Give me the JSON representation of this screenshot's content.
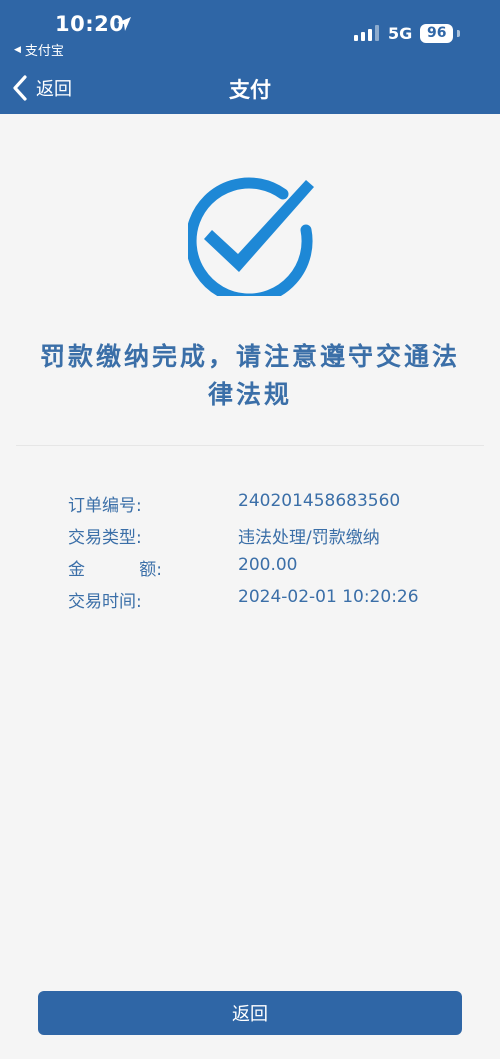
{
  "status_bar": {
    "time": "10:20",
    "back_app": "支付宝",
    "network": "5G",
    "battery": "96"
  },
  "nav": {
    "back_label": "返回",
    "title": "支付"
  },
  "result": {
    "message": "罚款缴纳完成，请注意遵守交通法律法规"
  },
  "details": {
    "order_no": {
      "label": "订单编号:",
      "value": "240201458683560"
    },
    "type": {
      "label": "交易类型:",
      "value": "违法处理/罚款缴纳"
    },
    "amount": {
      "label_chars": [
        "金",
        "额:"
      ],
      "value": "200.00"
    },
    "time": {
      "label": "交易时间:",
      "value": "2024-02-01 10:20:26"
    }
  },
  "footer": {
    "button_label": "返回"
  },
  "colors": {
    "brand": "#2f66a6",
    "accent": "#1e88d6",
    "text": "#3b6fa8",
    "background": "#f5f5f5"
  },
  "icons": [
    "location-arrow-icon",
    "signal-bars-icon",
    "chevron-left-icon",
    "success-check-icon"
  ]
}
